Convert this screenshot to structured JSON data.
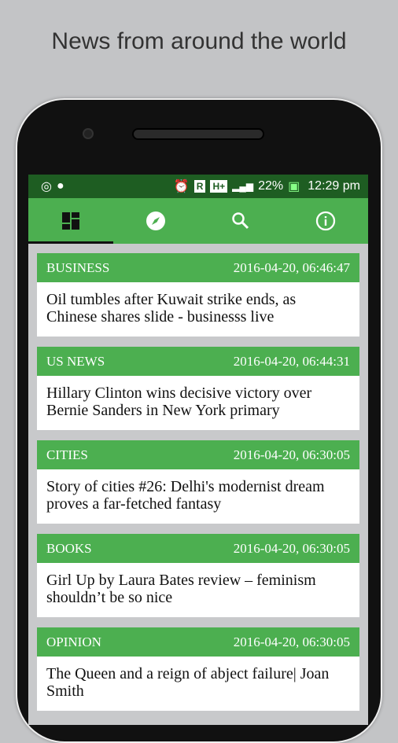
{
  "headline": "News from around the world",
  "status": {
    "battery": "22%",
    "time": "12:29 pm",
    "r_badge": "R",
    "network": "H+"
  },
  "tabs": [
    {
      "name": "dashboard"
    },
    {
      "name": "explore"
    },
    {
      "name": "search"
    },
    {
      "name": "info"
    }
  ],
  "articles": [
    {
      "category": "BUSINESS",
      "date": "2016-04-20, 06:46:47",
      "title": "Oil tumbles after Kuwait strike ends, as Chinese shares slide - businesss live"
    },
    {
      "category": "US NEWS",
      "date": "2016-04-20, 06:44:31",
      "title": "Hillary Clinton wins decisive victory over Bernie Sanders in New York primary"
    },
    {
      "category": "CITIES",
      "date": "2016-04-20, 06:30:05",
      "title": "Story of cities #26: Delhi's modernist dream proves a far-fetched fantasy"
    },
    {
      "category": "BOOKS",
      "date": "2016-04-20, 06:30:05",
      "title": "Girl Up by Laura Bates review – feminism shouldn’t be so nice"
    },
    {
      "category": "OPINION",
      "date": "2016-04-20, 06:30:05",
      "title": "The Queen and a reign of abject failure| Joan Smith"
    }
  ]
}
